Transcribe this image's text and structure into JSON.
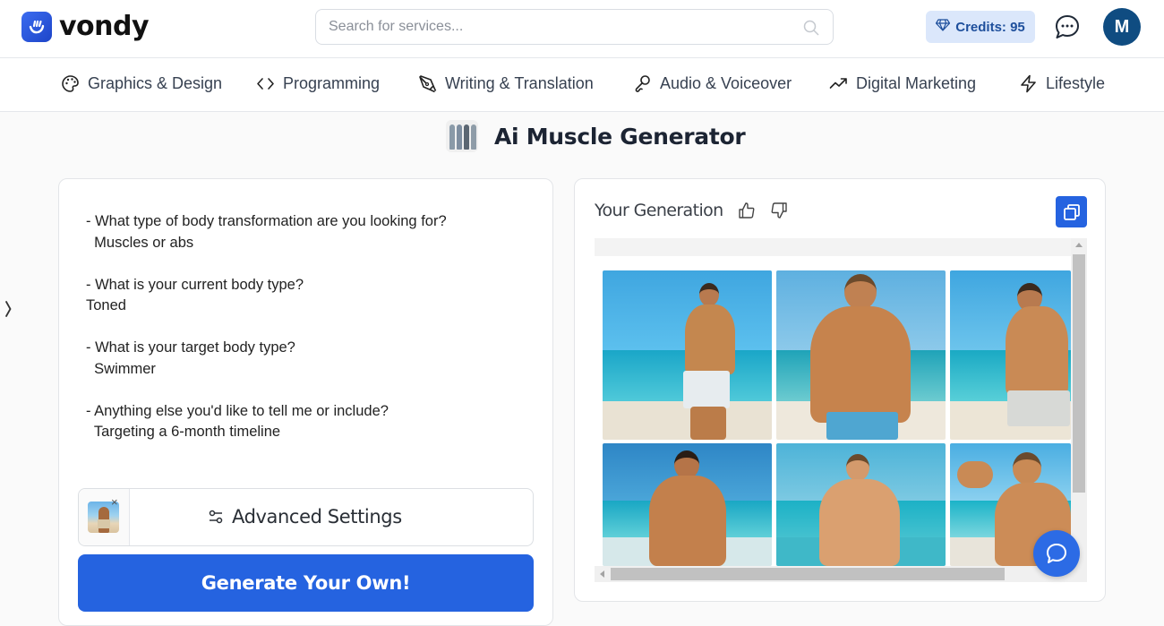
{
  "header": {
    "brand": "vondy",
    "search_placeholder": "Search for services...",
    "credits_label": "Credits: 95",
    "avatar_initial": "M"
  },
  "categories": [
    {
      "label": "Graphics & Design",
      "icon": "palette-icon"
    },
    {
      "label": "Programming",
      "icon": "code-icon"
    },
    {
      "label": "Writing & Translation",
      "icon": "pen-nib-icon"
    },
    {
      "label": "Audio & Voiceover",
      "icon": "microphone-icon"
    },
    {
      "label": "Digital Marketing",
      "icon": "trending-up-icon"
    },
    {
      "label": "Lifestyle",
      "icon": "lightning-icon"
    }
  ],
  "page": {
    "title": "Ai Muscle Generator"
  },
  "form": {
    "prompt_text": "- What type of body transformation are you looking for?\n  Muscles or abs\n\n- What is your current body type?\nToned\n\n- What is your target body type?\n  Swimmer\n\n- Anything else you'd like to tell me or include?\n  Targeting a 6-month timeline",
    "advanced_settings_label": "Advanced Settings",
    "remove_reference_label": "×",
    "generate_label": "Generate Your Own!"
  },
  "output": {
    "title": "Your Generation",
    "images": [
      {
        "alt": "Man on beach in floral white shorts"
      },
      {
        "alt": "Muscular man with sunglasses in blue shorts"
      },
      {
        "alt": "Man in patterned shorts by the sea"
      },
      {
        "alt": "Shirtless man on beach"
      },
      {
        "alt": "Man in sunglasses looking sideways"
      },
      {
        "alt": "Man flexing with mirrored sunglasses"
      }
    ]
  },
  "colors": {
    "accent": "#2563e0",
    "credits_bg": "#dbe7fb",
    "avatar_bg": "#0f4c81"
  }
}
